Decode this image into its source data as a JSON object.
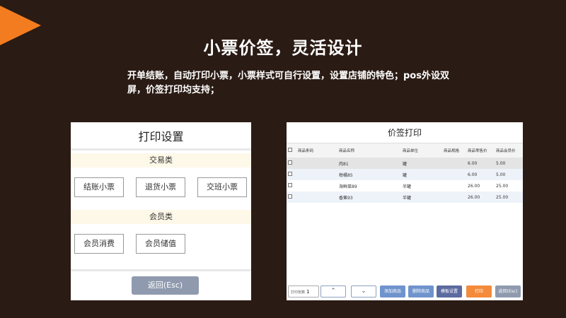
{
  "slide": {
    "title": "小票价签，灵活设计",
    "subtitle": "开单结账，自动打印小票，小票样式可自行设置，设置店铺的特色；pos外设双屏，价签打印均支持；"
  },
  "print_settings": {
    "title": "打印设置",
    "section_trade": "交易类",
    "trade_buttons": [
      "结账小票",
      "退货小票",
      "交班小票"
    ],
    "section_member": "会员类",
    "member_buttons": [
      "会员消费",
      "会员储值"
    ],
    "back_label": "返回(Esc)"
  },
  "price_tag": {
    "title": "价签打印",
    "columns": [
      "商品条码",
      "商品名称",
      "商品单位",
      "商品规格",
      "商品零售价",
      "商品会员价"
    ],
    "rows": [
      {
        "barcode": "",
        "name": "肉81",
        "unit": "罐",
        "spec": "",
        "retail": "6.00",
        "member": "5.00"
      },
      {
        "barcode": "",
        "name": "柑橘85",
        "unit": "罐",
        "spec": "",
        "retail": "6.00",
        "member": "5.00"
      },
      {
        "barcode": "",
        "name": "海鲜菜89",
        "unit": "半罐",
        "spec": "",
        "retail": "26.00",
        "member": "25.00"
      },
      {
        "barcode": "",
        "name": "香蕉93",
        "unit": "半罐",
        "spec": "",
        "retail": "26.00",
        "member": "25.00"
      }
    ],
    "pager_label": "打印张数",
    "pager_value": "1",
    "up_icon": "chevron-up-icon",
    "down_icon": "chevron-down-icon",
    "add_label": "添加商品",
    "delete_label": "删除商品",
    "template_label": "模板设置",
    "print_label": "打印",
    "back_label": "返回(Esc)"
  },
  "colors": {
    "background": "#2a1b14",
    "accent": "#f47c20",
    "blue_button": "#6f93cc",
    "dark_button": "#5b6aa0",
    "orange_button": "#f48a3c",
    "gray_button": "#8f9aae"
  }
}
